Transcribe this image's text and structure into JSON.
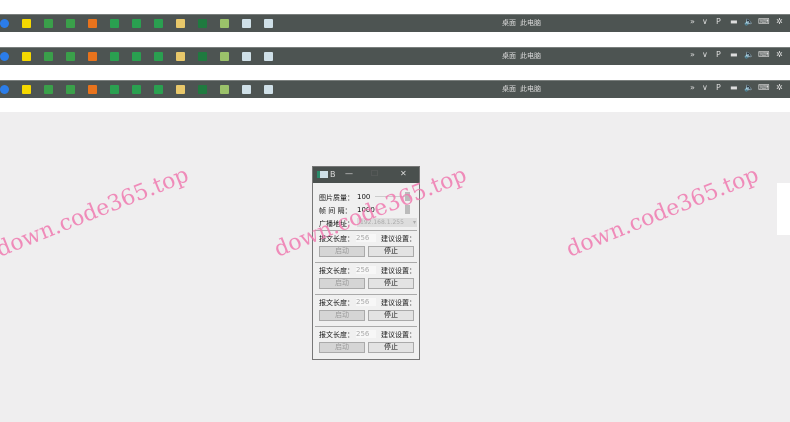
{
  "taskbar": {
    "desktop_label": "桌面",
    "pc_label": "此电脑",
    "tray": [
      "»",
      "∨",
      "P",
      "▬",
      "🔈",
      "⌨",
      "✲"
    ]
  },
  "taskbar_icon_colors": [
    "#2b7de9",
    "#f5d800",
    "#3aa04a",
    "#3aa04a",
    "#e8731c",
    "#2aa050",
    "#2aa050",
    "#2aa050",
    "#e8c86a",
    "#1f7a3f",
    "#9bc26a",
    "#cfe0e8",
    "#cfe0e8"
  ],
  "window": {
    "title": "B",
    "min": "—",
    "max": "☐",
    "close": "✕",
    "quality_label": "图片质量：",
    "quality_value": "100",
    "interval_label": "帧 间 隔：",
    "interval_value": "1000",
    "broadcast_label": "广播地址：",
    "broadcast_value": "192.168.1.255",
    "groups": [
      {
        "len_label": "报文长度：",
        "len_value": "256",
        "suggest": "建议设置：",
        "start": "启动",
        "stop": "停止"
      },
      {
        "len_label": "报文长度：",
        "len_value": "256",
        "suggest": "建议设置：",
        "start": "启动",
        "stop": "停止"
      },
      {
        "len_label": "报文长度：",
        "len_value": "256",
        "suggest": "建议设置：",
        "start": "启动",
        "stop": "停止"
      },
      {
        "len_label": "报文长度：",
        "len_value": "256",
        "suggest": "建议设置：",
        "start": "启动",
        "stop": "停止"
      }
    ]
  },
  "watermark": "down.code365.top"
}
